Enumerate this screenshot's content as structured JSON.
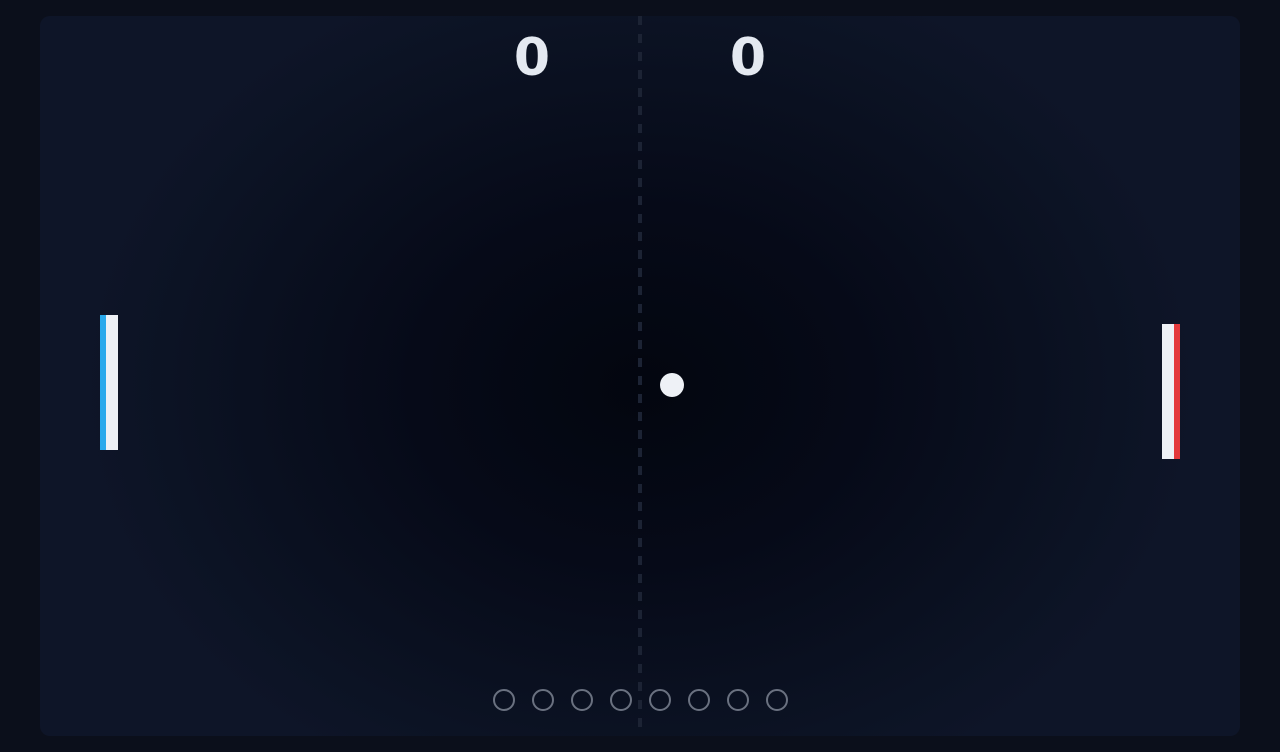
{
  "scoreboard": {
    "left_score": "0",
    "right_score": "0"
  },
  "players": {
    "left_paddle_color": "#29a9ec",
    "right_paddle_color": "#e4393c"
  },
  "rally_indicator": {
    "total_dots": 8,
    "filled_dots": 0
  }
}
